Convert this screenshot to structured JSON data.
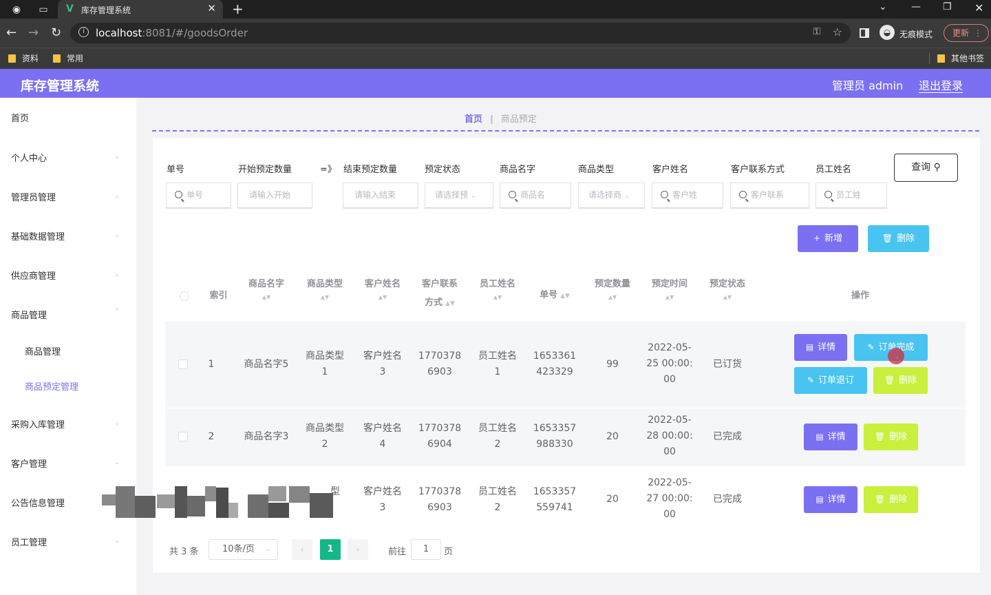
{
  "browser": {
    "tab_title": "库存管理系统",
    "url_host": "localhost",
    "url_rest": ":8081/#/goodsOrder",
    "incognito_label": "无痕模式",
    "update_label": "更新",
    "bookmarks": [
      "资料",
      "常用"
    ],
    "other_bookmarks": "其他书签"
  },
  "header": {
    "title": "库存管理系统",
    "user": "管理员 admin",
    "logout": "退出登录"
  },
  "sidebar": {
    "items": [
      {
        "label": "首页"
      },
      {
        "label": "个人中心"
      },
      {
        "label": "管理员管理"
      },
      {
        "label": "基础数据管理"
      },
      {
        "label": "供应商管理"
      },
      {
        "label": "商品管理"
      },
      {
        "label": "商品管理"
      },
      {
        "label": "商品预定管理"
      },
      {
        "label": "采购入库管理"
      },
      {
        "label": "客户管理"
      },
      {
        "label": "公告信息管理"
      },
      {
        "label": "员工管理"
      }
    ]
  },
  "breadcrumb": {
    "home": "首页",
    "current": "商品预定"
  },
  "filters": {
    "labels": [
      "单号",
      "开始预定数量",
      "=》",
      "结束预定数量",
      "预定状态",
      "商品名字",
      "商品类型",
      "客户姓名",
      "客户联系方式",
      "员工姓名"
    ],
    "placeholders": [
      "单号",
      "请输入开始",
      "请输入结束",
      "请选择预",
      "商品名",
      "请选择商",
      "客户姓",
      "客户联系",
      "员工姓"
    ],
    "query": "查询"
  },
  "actions": {
    "add": "新增",
    "delete": "删除"
  },
  "table": {
    "headers": {
      "index": "索引",
      "goods_name": "商品名字",
      "goods_type": "商品类型",
      "customer_name": "客户姓名",
      "customer_contact_1": "客户联系",
      "customer_contact_2": "方式",
      "staff_name": "员工姓名",
      "order_no": "单号",
      "quantity": "预定数量",
      "time": "预定时间",
      "status": "预定状态",
      "ops": "操作"
    },
    "rows": [
      {
        "index": "1",
        "goods_name": "商品名字5",
        "goods_type_1": "商品类型",
        "goods_type_2": "1",
        "customer_1": "客户姓名",
        "customer_2": "3",
        "contact_1": "1770378",
        "contact_2": "6903",
        "staff_1": "员工姓名",
        "staff_2": "1",
        "order_1": "1653361",
        "order_2": "423329",
        "quantity": "99",
        "time_1": "2022-05-",
        "time_2": "25 00:00:",
        "time_3": "00",
        "status": "已订货"
      },
      {
        "index": "2",
        "goods_name": "商品名字3",
        "goods_type_1": "商品类型",
        "goods_type_2": "2",
        "customer_1": "客户姓名",
        "customer_2": "4",
        "contact_1": "1770378",
        "contact_2": "6904",
        "staff_1": "员工姓名",
        "staff_2": "2",
        "order_1": "1653357",
        "order_2": "988330",
        "quantity": "20",
        "time_1": "2022-05-",
        "time_2": "28 00:00:",
        "time_3": "00",
        "status": "已完成"
      },
      {
        "goods_type_partial": "型",
        "customer_1": "客户姓名",
        "customer_2": "3",
        "contact_1": "1770378",
        "contact_2": "6903",
        "staff_1": "员工姓名",
        "staff_2": "2",
        "order_1": "1653357",
        "order_2": "559741",
        "quantity": "20",
        "time_1": "2022-05-",
        "time_2": "27 00:00:",
        "time_3": "00",
        "status": "已完成"
      }
    ],
    "row_actions": {
      "detail": "详情",
      "complete": "订单完成",
      "cancel": "订单退订",
      "delete": "删除"
    }
  },
  "pagination": {
    "total": "共 3 条",
    "page_size": "10条/页",
    "current_page": "1",
    "goto_label": "前往",
    "goto_value": "1",
    "page_suffix": "页"
  }
}
